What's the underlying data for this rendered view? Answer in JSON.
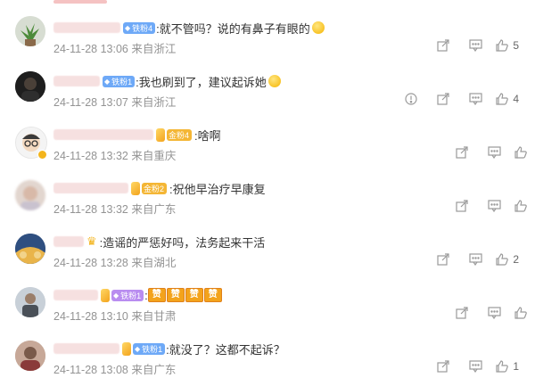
{
  "comments": [
    {
      "badge_label": "铁粉4",
      "badge_color": "#6ea9f7",
      "text": ":就不管吗？说的有鼻子有眼的",
      "emoji": "laughing-tears-emoji",
      "timestamp": "24-11-28 13:06",
      "location": "来自浙江",
      "actions": [
        "share",
        "comment",
        "like"
      ],
      "likes": "5"
    },
    {
      "badge_label": "铁粉1",
      "badge_color": "#6ea9f7",
      "text": ":我也刷到了，建议起诉她",
      "emoji": "laughing-tears-emoji",
      "timestamp": "24-11-28 13:07",
      "location": "来自浙江",
      "actions": [
        "report",
        "share",
        "comment",
        "like"
      ],
      "likes": "4"
    },
    {
      "badge_label": "金粉4",
      "badge_color": "#f4b635",
      "text": ":啥啊",
      "timestamp": "24-11-28 13:32",
      "location": "来自重庆",
      "actions": [
        "share",
        "comment",
        "like"
      ],
      "likes": ""
    },
    {
      "badge_label": "金粉2",
      "badge_color": "#f4b635",
      "text": ":祝他早治疗早康复",
      "timestamp": "24-11-28 13:32",
      "location": "来自广东",
      "actions": [
        "share",
        "comment",
        "like"
      ],
      "likes": ""
    },
    {
      "text": ":造谣的严惩好吗，法务起来干活",
      "timestamp": "24-11-28 13:28",
      "location": "来自湖北",
      "actions": [
        "share",
        "comment",
        "like"
      ],
      "likes": "2"
    },
    {
      "badge_label": "铁粉1",
      "badge_color": "#b98df0",
      "text": ":",
      "sticker_text": "赞",
      "timestamp": "24-11-28 13:10",
      "location": "来自甘肃",
      "actions": [
        "share",
        "comment",
        "like"
      ],
      "likes": ""
    },
    {
      "badge_label": "铁粉1",
      "badge_color": "#6ea9f7",
      "text": ":就没了？这都不起诉？",
      "timestamp": "24-11-28 13:08",
      "location": "来自广东",
      "actions": [
        "share",
        "comment",
        "like"
      ],
      "likes": "1"
    }
  ]
}
